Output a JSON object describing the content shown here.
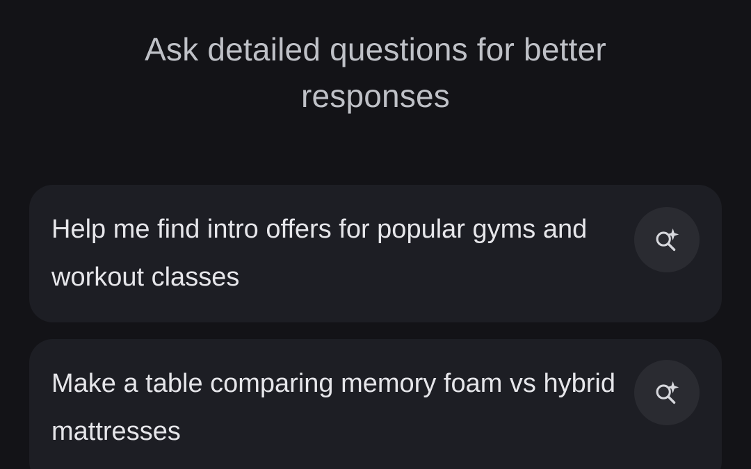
{
  "header": {
    "title": "Ask detailed questions for better responses"
  },
  "suggestions": [
    {
      "text": "Help me find intro offers for popular gyms and workout classes",
      "icon": "search-sparkle-icon"
    },
    {
      "text": "Make a table comparing memory foam vs hybrid mattresses",
      "icon": "search-sparkle-icon"
    }
  ],
  "colors": {
    "background": "#131317",
    "card": "#1d1e24",
    "icon_button": "#2a2b31",
    "heading_text": "#bfc1c7",
    "card_text": "#e6e6ea"
  }
}
